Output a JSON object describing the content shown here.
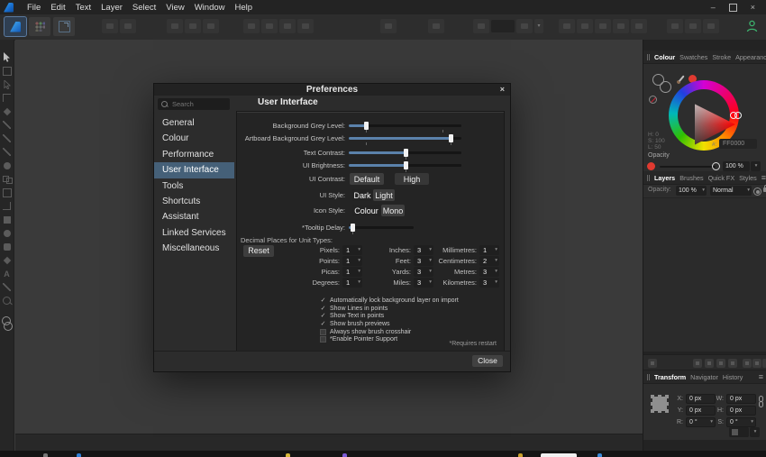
{
  "icons": {
    "menu_glyph": "≡",
    "chevron": "▾",
    "check": "✓",
    "close": "×",
    "minimize": "–",
    "text_tool": "A"
  },
  "colors": {
    "accent_selection": "#456078",
    "slider_fill": "#5b82ab",
    "swatch_red": "#ff0000",
    "account_green": "#3db36e"
  },
  "menu": {
    "items": [
      "File",
      "Edit",
      "Text",
      "Layer",
      "Select",
      "View",
      "Window",
      "Help"
    ]
  },
  "dialog": {
    "title": "Preferences",
    "search_placeholder": "Search",
    "header": "User Interface",
    "sidebar": [
      "General",
      "Colour",
      "Performance",
      "User Interface",
      "Tools",
      "Shortcuts",
      "Assistant",
      "Linked Services",
      "Miscellaneous"
    ],
    "selected_sidebar": "User Interface",
    "sliders": [
      {
        "label": "Background Grey Level:",
        "value_pct": 15
      },
      {
        "label": "Artboard Background Grey Level:",
        "value_pct": 90
      },
      {
        "label": "Text Contrast:",
        "value_pct": 50
      },
      {
        "label": "UI Brightness:",
        "value_pct": 50
      }
    ],
    "ui_contrast": {
      "label": "UI Contrast:",
      "options": [
        "Default",
        "High"
      ],
      "selected": "Default"
    },
    "ui_style": {
      "label": "UI Style:",
      "options": [
        "Dark",
        "Light"
      ],
      "selected": "Dark"
    },
    "icon_style": {
      "label": "Icon Style:",
      "options": [
        "Colour",
        "Mono"
      ],
      "selected": "Colour"
    },
    "tooltip_delay": {
      "label": "*Tooltip Delay:",
      "value_pct": 5
    },
    "decimal_places": {
      "label": "Decimal Places for Unit Types:",
      "reset_label": "Reset",
      "columns": [
        [
          {
            "label": "Pixels:",
            "value": "1"
          },
          {
            "label": "Points:",
            "value": "1"
          },
          {
            "label": "Picas:",
            "value": "1"
          },
          {
            "label": "Degrees:",
            "value": "1"
          }
        ],
        [
          {
            "label": "Inches:",
            "value": "3"
          },
          {
            "label": "Feet:",
            "value": "3"
          },
          {
            "label": "Yards:",
            "value": "3"
          },
          {
            "label": "Miles:",
            "value": "3"
          }
        ],
        [
          {
            "label": "Millimetres:",
            "value": "1"
          },
          {
            "label": "Centimetres:",
            "value": "2"
          },
          {
            "label": "Metres:",
            "value": "3"
          },
          {
            "label": "Kilometres:",
            "value": "3"
          }
        ]
      ]
    },
    "checkboxes": [
      {
        "label": "Automatically lock background layer on import",
        "checked": true
      },
      {
        "label": "Show Lines in points",
        "checked": true
      },
      {
        "label": "Show Text in points",
        "checked": true
      },
      {
        "label": "Show brush previews",
        "checked": true
      },
      {
        "label": "Always show brush crosshair",
        "checked": false
      },
      {
        "label": "*Enable Pointer Support",
        "checked": false
      }
    ],
    "requires_restart": "*Requires restart",
    "close_label": "Close"
  },
  "colour_panel": {
    "tabs": [
      "Colour",
      "Swatches",
      "Stroke",
      "Appearance"
    ],
    "selected_tab": "Colour",
    "hsl": {
      "h": "H: 0",
      "s": "S: 100",
      "l": "L: 50"
    },
    "hex_label": "#:",
    "hex_value": "FF0000",
    "opacity_label": "Opacity",
    "opacity_value": "100 %"
  },
  "layers_panel": {
    "tabs": [
      "Layers",
      "Brushes",
      "Quick FX",
      "Styles"
    ],
    "selected_tab": "Layers",
    "opacity_label": "Opacity:",
    "opacity_value": "100 %",
    "blend_mode": "Normal"
  },
  "transform_panel": {
    "tabs": [
      "Transform",
      "Navigator",
      "History"
    ],
    "selected_tab": "Transform",
    "fields": [
      {
        "label": "X:",
        "value": "0 px"
      },
      {
        "label": "W:",
        "value": "0 px"
      },
      {
        "label": "Y:",
        "value": "0 px"
      },
      {
        "label": "H:",
        "value": "0 px"
      },
      {
        "label": "R:",
        "value": "0 °"
      },
      {
        "label": "S:",
        "value": "0 °"
      }
    ]
  }
}
